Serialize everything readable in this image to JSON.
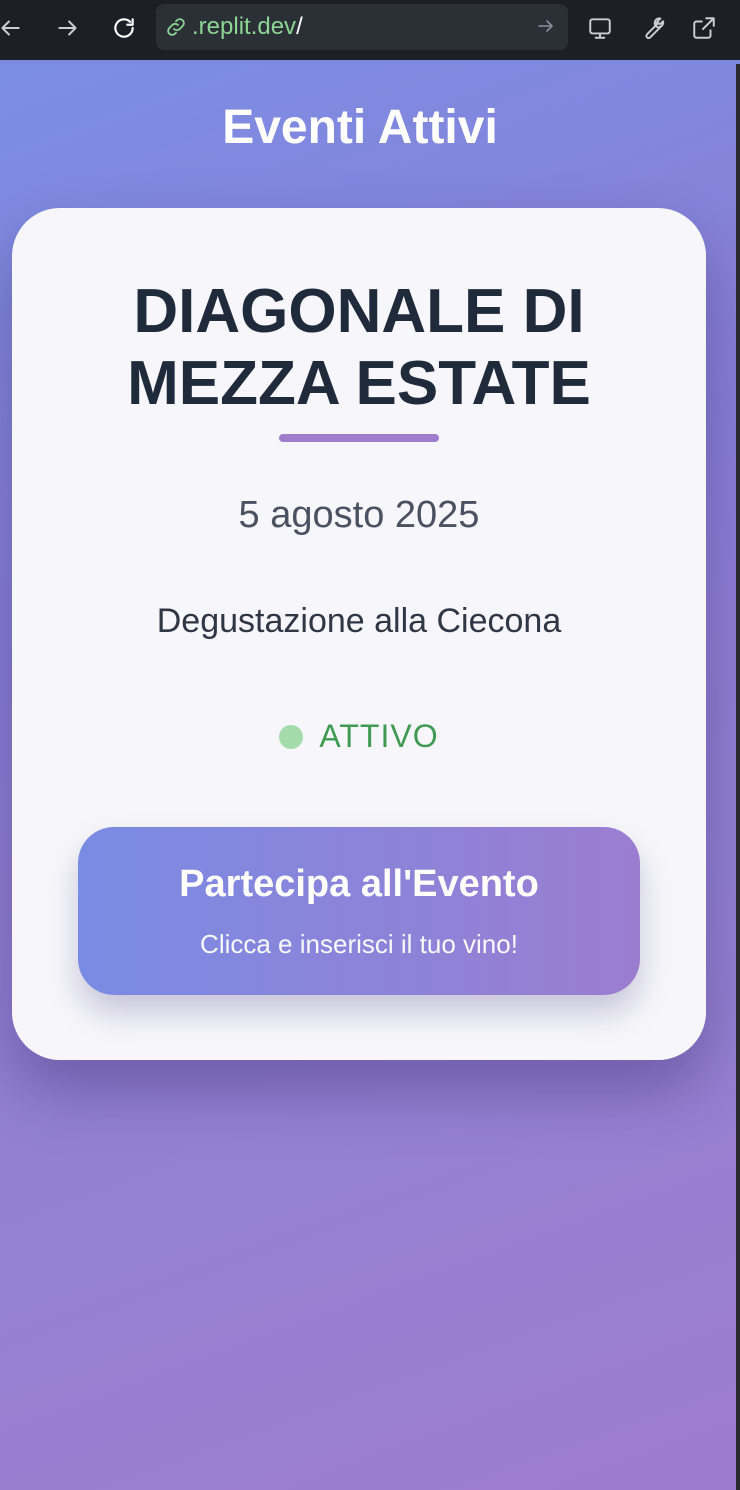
{
  "browser": {
    "url_domain": ".replit.dev",
    "url_path": "/",
    "url_color": "#8cd694"
  },
  "page": {
    "title": "Eventi Attivi"
  },
  "event": {
    "name": "DIAGONALE DI MEZZA ESTATE",
    "date": "5 agosto 2025",
    "description": "Degustazione alla Ciecona",
    "status": "ATTIVO",
    "status_color": "#3f9a52"
  },
  "cta": {
    "title": "Partecipa all'Evento",
    "subtitle": "Clicca e inserisci il tuo vino!"
  },
  "icons": {
    "back": "arrow-left-icon",
    "forward": "arrow-right-icon",
    "reload": "reload-icon",
    "link": "link-icon",
    "go": "arrow-right-icon",
    "devices": "monitor-icon",
    "tools": "wrench-icon",
    "open": "external-link-icon"
  }
}
